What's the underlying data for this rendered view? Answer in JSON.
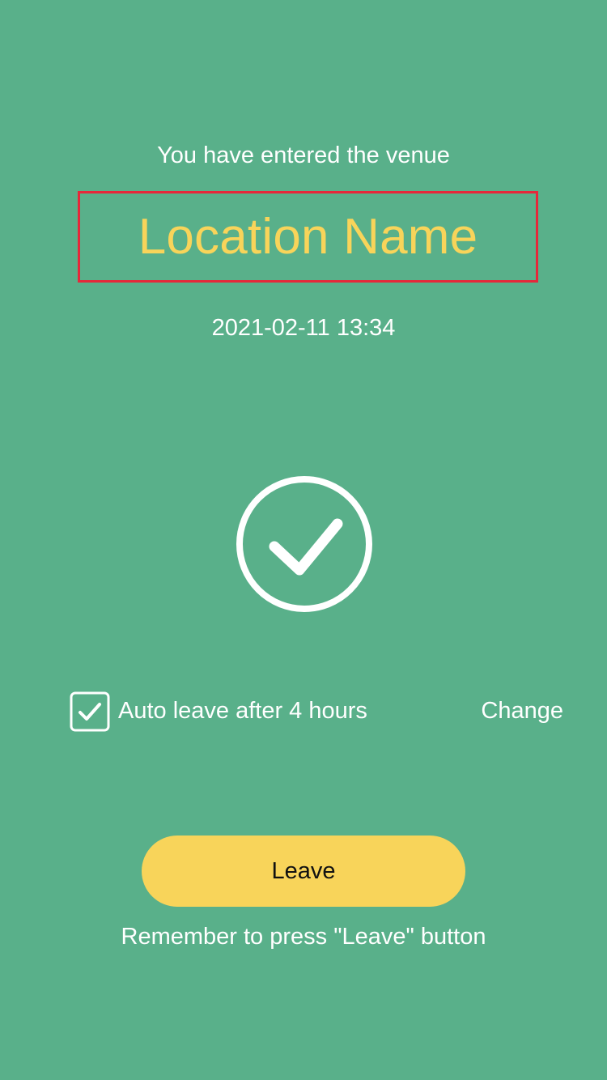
{
  "venue": {
    "entered_text": "You have entered the venue",
    "location_name": "Location Name",
    "datetime": "2021-02-11 13:34"
  },
  "status_icon": {
    "name": "check-circle-icon",
    "color": "#FFFFFF"
  },
  "auto_leave": {
    "checked": true,
    "checkbox_icon": "checkbox-checked-icon",
    "label": "Auto leave after 4 hours",
    "change_label": "Change"
  },
  "actions": {
    "leave_label": "Leave",
    "reminder": "Remember to press \"Leave\" button"
  },
  "colors": {
    "background": "#59B08A",
    "accent": "#F8D45A",
    "highlight_border": "#E5283A",
    "text": "#FFFFFF"
  }
}
